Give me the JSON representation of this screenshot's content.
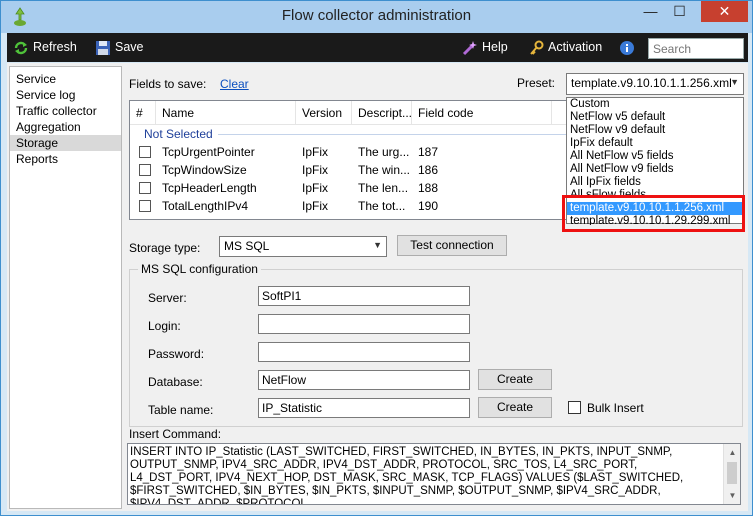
{
  "window": {
    "title": "Flow collector administration"
  },
  "toolbar": {
    "refresh_label": "Refresh",
    "save_label": "Save",
    "help_label": "Help",
    "activation_label": "Activation",
    "search_placeholder": "Search"
  },
  "nav": {
    "items": [
      {
        "label": "Service",
        "selected": false
      },
      {
        "label": "Service log",
        "selected": false
      },
      {
        "label": "Traffic collector",
        "selected": false
      },
      {
        "label": "Aggregation",
        "selected": false
      },
      {
        "label": "Storage",
        "selected": true
      },
      {
        "label": "Reports",
        "selected": false
      }
    ]
  },
  "fields": {
    "label": "Fields to save:",
    "clear_label": "Clear",
    "preset_label": "Preset:",
    "preset_value": "template.v9.10.10.1.1.256.xml",
    "columns": [
      "#",
      "Name",
      "Version",
      "Descript...",
      "Field code"
    ],
    "group_label": "Not Selected",
    "rows": [
      {
        "name": "TcpUrgentPointer",
        "version": "IpFix",
        "desc": "The urg...",
        "code": "187"
      },
      {
        "name": "TcpWindowSize",
        "version": "IpFix",
        "desc": "The win...",
        "code": "186"
      },
      {
        "name": "TcpHeaderLength",
        "version": "IpFix",
        "desc": "The len...",
        "code": "188"
      },
      {
        "name": "TotalLengthIPv4",
        "version": "IpFix",
        "desc": "The tot...",
        "code": "190"
      }
    ]
  },
  "preset_dropdown": {
    "options": [
      "Custom",
      "NetFlow v5 default",
      "NetFlow v9 default",
      "IpFix default",
      "All NetFlow v5 fields",
      "All NetFlow v9 fields",
      "All IpFix fields",
      "All sFlow fields",
      "template.v9.10.10.1.1.256.xml",
      "template.v9.10.10.1.29.299.xml"
    ],
    "selected_index": 8
  },
  "storage": {
    "type_label": "Storage type:",
    "type_value": "MS SQL",
    "test_button": "Test connection",
    "config_title": "MS SQL configuration",
    "server_label": "Server:",
    "server_value": "SoftPI1",
    "login_label": "Login:",
    "login_value": "",
    "password_label": "Password:",
    "password_value": "",
    "database_label": "Database:",
    "database_value": "NetFlow",
    "table_label": "Table name:",
    "table_value": "IP_Statistic",
    "create_label": "Create",
    "bulk_label": "Bulk Insert",
    "insert_label": "Insert Command:",
    "insert_text": "INSERT INTO IP_Statistic (LAST_SWITCHED, FIRST_SWITCHED, IN_BYTES, IN_PKTS, INPUT_SNMP, OUTPUT_SNMP, IPV4_SRC_ADDR, IPV4_DST_ADDR, PROTOCOL, SRC_TOS, L4_SRC_PORT, L4_DST_PORT, IPV4_NEXT_HOP, DST_MASK, SRC_MASK, TCP_FLAGS) VALUES ($LAST_SWITCHED, $FIRST_SWITCHED, $IN_BYTES, $IN_PKTS, $INPUT_SNMP, $OUTPUT_SNMP, $IPV4_SRC_ADDR, $IPV4_DST_ADDR, $PROTOCOL,"
  },
  "colors": {
    "titlebar": "#a9cdee",
    "toolbar": "#1a1a1a",
    "close": "#c7402f",
    "selection": "#3399ff",
    "highlight": "#e11111"
  }
}
